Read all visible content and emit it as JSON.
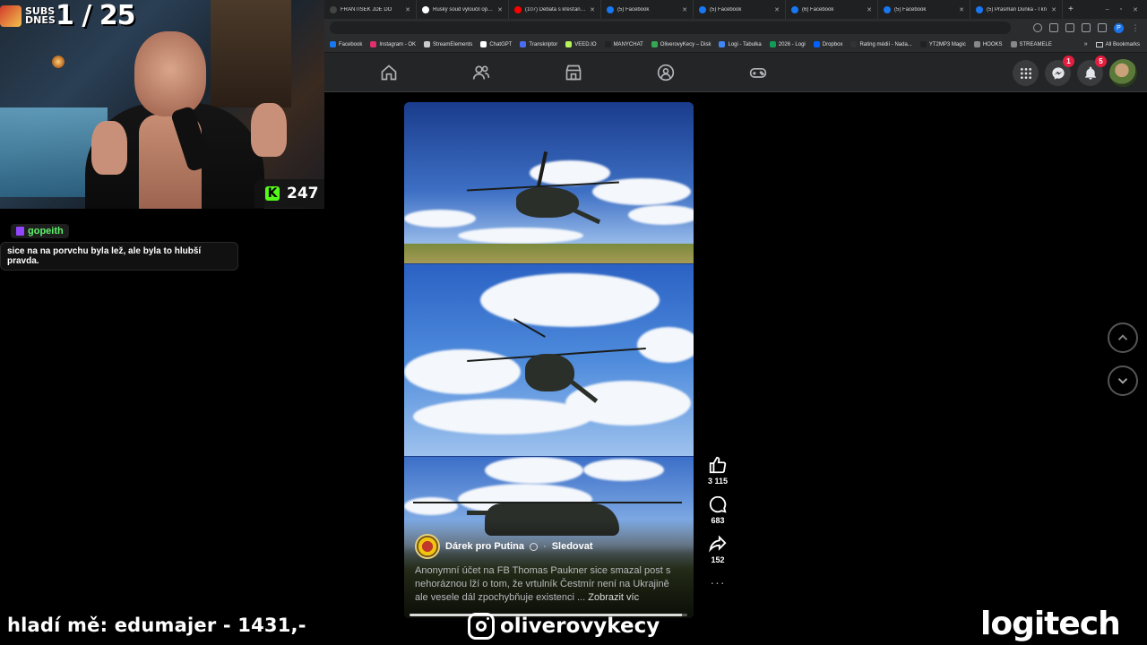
{
  "browser": {
    "tabs": [
      {
        "label": "FRANTIŠEK JDE DO",
        "color": "#444444"
      },
      {
        "label": "Ruský soud vyloučil opozi",
        "color": "#ffffff"
      },
      {
        "label": "(107) Debata s křesťany n",
        "color": "#ff0000"
      },
      {
        "label": "(5) Facebook",
        "color": "#1877f2"
      },
      {
        "label": "(5) Facebook",
        "color": "#1877f2"
      },
      {
        "label": "(6) Facebook",
        "color": "#1877f2"
      },
      {
        "label": "(5) Facebook",
        "color": "#1877f2"
      },
      {
        "label": "(5) Prasman Dunka - I kn",
        "color": "#1877f2"
      }
    ],
    "new_tab": "+",
    "bookmarks": [
      {
        "label": "Facebook",
        "color": "#1877f2"
      },
      {
        "label": "Instagram - OK",
        "color": "#e1306c"
      },
      {
        "label": "StreamElements",
        "color": "#cccccc"
      },
      {
        "label": "ChatGPT",
        "color": "#ffffff"
      },
      {
        "label": "Transkriptor",
        "color": "#4a6cf7"
      },
      {
        "label": "VEED.IO",
        "color": "#b6f25a"
      },
      {
        "label": "MANYCHAT",
        "color": "#222222"
      },
      {
        "label": "OliverovyKecy – Disk",
        "color": "#34a853"
      },
      {
        "label": "Logi - Tabulka",
        "color": "#4285f4"
      },
      {
        "label": "2026 - Logi",
        "color": "#0f9d58"
      },
      {
        "label": "Dropbox",
        "color": "#0061ff"
      },
      {
        "label": "Rating médií - Nada...",
        "color": "#333333"
      },
      {
        "label": "YT2MP3 Magic",
        "color": "#222222"
      },
      {
        "label": "HOOKS",
        "color": "#888888"
      },
      {
        "label": "STREAMELE",
        "color": "#888888"
      }
    ],
    "bookmarks_more": "»",
    "all_bookmarks": "All Bookmarks",
    "profile_initial": "P"
  },
  "fb_nav": {
    "messenger_badge": "1",
    "notifications_badge": "5"
  },
  "stream": {
    "subs_label": "SUBS DNES",
    "subs_count": "1 / 25",
    "kick_viewers": "247",
    "chat_user": "gopeith",
    "chat_message": "sice na na porvchu byla lež, ale byla to hlubší pravda.",
    "donation_text": "hladí mě: edumajer - 1431,-",
    "instagram_handle": "oliverovykecy",
    "sponsor": "logitech"
  },
  "reel": {
    "author": "Dárek pro Putina",
    "separator": "·",
    "follow_label": "Sledovat",
    "caption": "Anonymní účet na FB Thomas Paukner sice smazal post s nehoráznou lží o tom, že vrtulník Čestmír není na Ukrajině ale vesele dál zpochybňuje existenci ...",
    "see_more": "Zobrazit víc",
    "progress": 0.98
  },
  "actions": {
    "likes": "3 115",
    "comments": "683",
    "shares": "152",
    "more": "···"
  }
}
